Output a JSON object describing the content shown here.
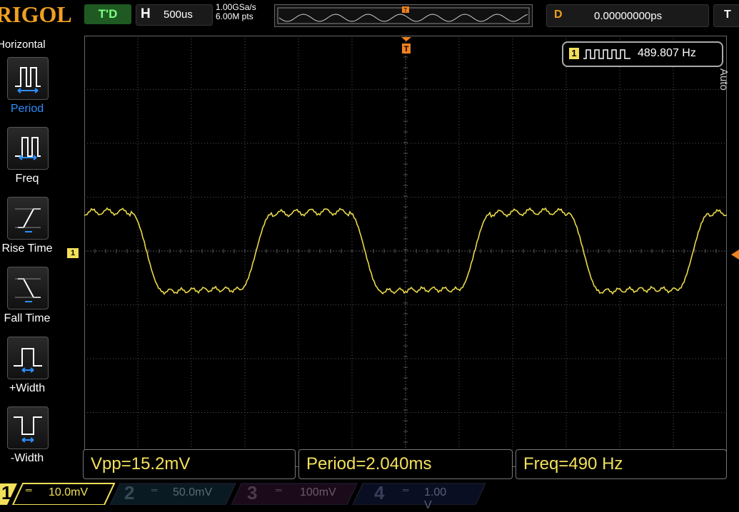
{
  "brand": "RIGOL",
  "status": {
    "run_state": "T'D",
    "horizontal_letter": "H",
    "timebase": "500us",
    "sample_rate": "1.00GSa/s",
    "memory_depth": "6.00M pts",
    "delay_letter": "D",
    "delay_value": "0.00000000ps",
    "trigger_letter": "T"
  },
  "menu": {
    "title": "Horizontal",
    "items": [
      {
        "label": "Period",
        "icon": "period-icon"
      },
      {
        "label": "Freq",
        "icon": "frequency-icon"
      },
      {
        "label": "Rise Time",
        "icon": "rise-time-icon"
      },
      {
        "label": "Fall Time",
        "icon": "fall-time-icon"
      },
      {
        "label": "+Width",
        "icon": "positive-width-icon"
      },
      {
        "label": "-Width",
        "icon": "negative-width-icon"
      }
    ]
  },
  "counter": {
    "channel": "1",
    "value": "489.807 Hz"
  },
  "side_label": "Auto",
  "measurements": [
    {
      "text": "Vpp=15.2mV"
    },
    {
      "text": "Period=2.040ms"
    },
    {
      "text": "Freq=490 Hz"
    }
  ],
  "channels": [
    {
      "num": "1",
      "scale": "10.0mV",
      "color": "#f2e05a",
      "active": true
    },
    {
      "num": "2",
      "scale": "50.0mV",
      "color": "#00b7ff",
      "active": false
    },
    {
      "num": "3",
      "scale": "100mV",
      "color": "#d400d4",
      "active": false
    },
    {
      "num": "4",
      "scale": "1.00 V",
      "color": "#2060ff",
      "active": false
    }
  ],
  "channel_marker": "1",
  "colors": {
    "trace": "#e8d84a",
    "accent": "#f0a020",
    "grid": "#555555"
  }
}
